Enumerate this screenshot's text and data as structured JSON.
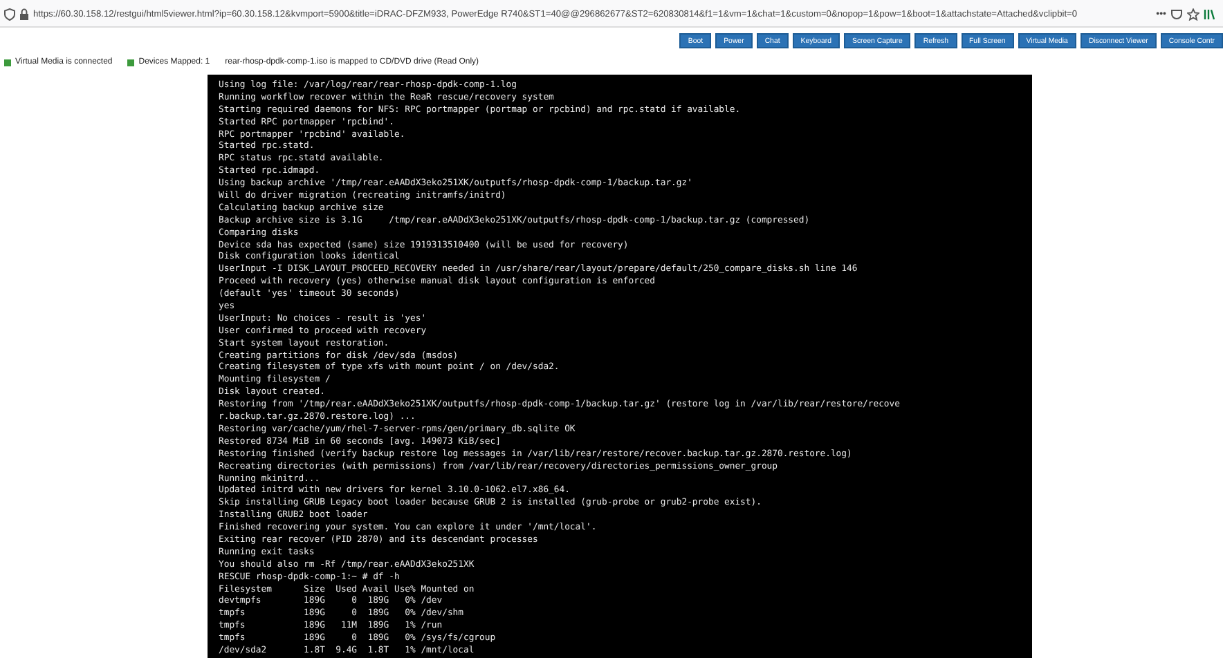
{
  "browser": {
    "url": "https://60.30.158.12/restgui/html5viewer.html?ip=60.30.158.12&kvmport=5900&title=iDRAC-DFZM933, PowerEdge R740&ST1=40@@296862677&ST2=620830814&f1=1&vm=1&chat=1&custom=0&nopop=1&pow=1&boot=1&attachstate=Attached&vclipbit=0",
    "menu": "•••"
  },
  "toolbar": {
    "buttons": [
      "Boot",
      "Power",
      "Chat",
      "Keyboard",
      "Screen Capture",
      "Refresh",
      "Full Screen",
      "Virtual Media",
      "Disconnect Viewer",
      "Console Contr"
    ]
  },
  "status": [
    {
      "text": "Virtual Media is connected",
      "color": "#3c9a3c"
    },
    {
      "text": "Devices Mapped: 1",
      "color": "#3c9a3c"
    },
    {
      "text": "rear-rhosp-dpdk-comp-1.iso is mapped to CD/DVD drive (Read Only)"
    }
  ],
  "console": {
    "lines": [
      "Using log file: /var/log/rear/rear-rhosp-dpdk-comp-1.log",
      "Running workflow recover within the ReaR rescue/recovery system",
      "Starting required daemons for NFS: RPC portmapper (portmap or rpcbind) and rpc.statd if available.",
      "Started RPC portmapper 'rpcbind'.",
      "RPC portmapper 'rpcbind' available.",
      "Started rpc.statd.",
      "RPC status rpc.statd available.",
      "Started rpc.idmapd.",
      "Using backup archive '/tmp/rear.eAADdX3eko251XK/outputfs/rhosp-dpdk-comp-1/backup.tar.gz'",
      "Will do driver migration (recreating initramfs/initrd)",
      "Calculating backup archive size",
      "Backup archive size is 3.1G     /tmp/rear.eAADdX3eko251XK/outputfs/rhosp-dpdk-comp-1/backup.tar.gz (compressed)",
      "Comparing disks",
      "Device sda has expected (same) size 1919313510400 (will be used for recovery)",
      "Disk configuration looks identical",
      "UserInput -I DISK_LAYOUT_PROCEED_RECOVERY needed in /usr/share/rear/layout/prepare/default/250_compare_disks.sh line 146",
      "Proceed with recovery (yes) otherwise manual disk layout configuration is enforced",
      "(default 'yes' timeout 30 seconds)",
      "yes",
      "UserInput: No choices - result is 'yes'",
      "User confirmed to proceed with recovery",
      "Start system layout restoration.",
      "Creating partitions for disk /dev/sda (msdos)",
      "Creating filesystem of type xfs with mount point / on /dev/sda2.",
      "Mounting filesystem /",
      "Disk layout created.",
      "Restoring from '/tmp/rear.eAADdX3eko251XK/outputfs/rhosp-dpdk-comp-1/backup.tar.gz' (restore log in /var/lib/rear/restore/recove",
      "r.backup.tar.gz.2870.restore.log) ...",
      "Restoring var/cache/yum/rhel-7-server-rpms/gen/primary_db.sqlite OK",
      "Restored 8734 MiB in 60 seconds [avg. 149073 KiB/sec]",
      "Restoring finished (verify backup restore log messages in /var/lib/rear/restore/recover.backup.tar.gz.2870.restore.log)",
      "Recreating directories (with permissions) from /var/lib/rear/recovery/directories_permissions_owner_group",
      "Running mkinitrd...",
      "Updated initrd with new drivers for kernel 3.10.0-1062.el7.x86_64.",
      "Skip installing GRUB Legacy boot loader because GRUB 2 is installed (grub-probe or grub2-probe exist).",
      "Installing GRUB2 boot loader",
      "Finished recovering your system. You can explore it under '/mnt/local'.",
      "Exiting rear recover (PID 2870) and its descendant processes",
      "Running exit tasks",
      "You should also rm -Rf /tmp/rear.eAADdX3eko251XK",
      "RESCUE rhosp-dpdk-comp-1:~ # df -h",
      "Filesystem      Size  Used Avail Use% Mounted on",
      "devtmpfs        189G     0  189G   0% /dev",
      "tmpfs           189G     0  189G   0% /dev/shm",
      "tmpfs           189G   11M  189G   1% /run",
      "tmpfs           189G     0  189G   0% /sys/fs/cgroup",
      "/dev/sda2       1.8T  9.4G  1.8T   1% /mnt/local"
    ]
  }
}
